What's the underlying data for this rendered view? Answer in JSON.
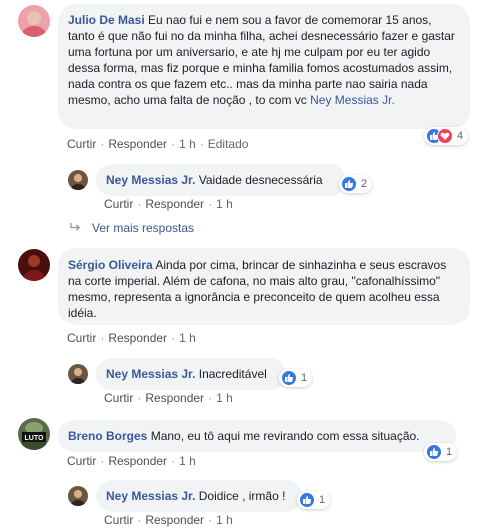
{
  "comments": [
    {
      "author": "Julio De Masi",
      "text": " Eu nao fui e nem sou a favor de comemorar 15 anos, tanto é que não fui no da minha filha, achei desnecessário fazer e gastar uma fortuna por um aniversario, e ate hj me culpam por eu ter agido dessa forma, mas fiz porque e minha familia fomos acostumados assim, nada contra os que fazem etc.. mas da minha parte nao sairia nada mesmo, acho uma falta de noção , to com vc ",
      "mention": "Ney Messias Jr.",
      "like_label": "Curtir",
      "reply_label": "Responder",
      "time": "1 h",
      "edited": "Editado",
      "reactions_count": "4",
      "reply": {
        "author": "Ney Messias Jr.",
        "text": " Vaidade desnecessária",
        "like_label": "Curtir",
        "reply_label": "Responder",
        "time": "1 h",
        "reactions_count": "2"
      },
      "more_replies": "Ver mais respostas"
    },
    {
      "author": "Sérgio Oliveira",
      "text": " Ainda por cima, brincar de sinhazinha e seus escravos na corte imperial. Além de cafona, no mais alto grau, \"cafonalhíssimo\" mesmo, representa a ignorância e preconceito de quem acolheu essa idéia.",
      "like_label": "Curtir",
      "reply_label": "Responder",
      "time": "1 h",
      "reply": {
        "author": "Ney Messias Jr.",
        "text": " Inacreditável",
        "like_label": "Curtir",
        "reply_label": "Responder",
        "time": "1 h",
        "reactions_count": "1"
      }
    },
    {
      "author": "Breno Borges",
      "text": " Mano, eu tô aqui me revirando com essa situação.",
      "avatar_text": "LUTO",
      "like_label": "Curtir",
      "reply_label": "Responder",
      "time": "1 h",
      "reactions_count": "1",
      "reply": {
        "author": "Ney Messias Jr.",
        "text": " Doidice , irmão !",
        "like_label": "Curtir",
        "reply_label": "Responder",
        "time": "1 h",
        "reactions_count": "1"
      }
    }
  ],
  "colors": {
    "link": "#385898",
    "bubble": "#f2f3f5",
    "like": "#3578e5",
    "love": "#f33e58"
  }
}
